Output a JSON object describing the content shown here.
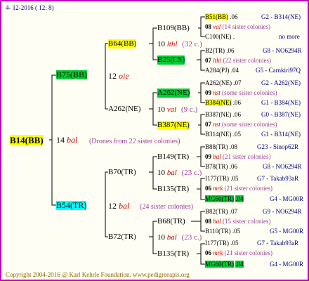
{
  "header": {
    "date": "4- 12-2016 ( 12: 8)"
  },
  "colors": {
    "yellow": "#ffff00",
    "green": "#00cc33",
    "cyan": "#00ffff",
    "text_purple": "#9a3c9a",
    "text_navy": "#000080",
    "text_red": "#d00000",
    "border": "#c000c0"
  },
  "root": {
    "id": "B14(BB)",
    "gen": "14",
    "loc": "bal",
    "note": "(Drones from 22 sister colonies)"
  },
  "sire": {
    "id": "B75(BB)",
    "gen": "12",
    "loc": "oie",
    "b64": {
      "id": "B64(BB)",
      "gen": "10",
      "loc": "lthl",
      "count": "(32 c.)"
    },
    "b109": {
      "id": "B109(BB)"
    },
    "b25": {
      "id": "B25(CS)"
    },
    "a262": {
      "id": "A262(NE)",
      "gen": "10",
      "loc": "val",
      "count": "(9 c.)"
    },
    "a262b": {
      "id": "A262(NE)"
    },
    "b387": {
      "id": "B387(NE)"
    }
  },
  "dam": {
    "id": "B54(TR)",
    "gen": "12",
    "loc": "bal",
    "note": "(24 sister colonies)",
    "b70": {
      "id": "B70(TR)",
      "gen": "10",
      "loc": "bal",
      "count": "(23 c.)"
    },
    "b149": {
      "id": "B149(TR)"
    },
    "b135": {
      "id": "B135(TR)"
    },
    "b72": {
      "id": "B72(TR)",
      "gen": "10",
      "loc": "bal",
      "count": "(23 c.)"
    },
    "b68": {
      "id": "B68(TR)"
    },
    "b135b": {
      "id": "B135(TR)"
    }
  },
  "rows": [
    {
      "a": "B51(BB)",
      "b": ".06",
      "c": "G2 - B314(NE)"
    },
    {
      "a": "08",
      "b": "val",
      "c": "(14 sister colonies)"
    },
    {
      "a": "C100(NE)",
      "b": ".",
      "c": "no more"
    },
    {
      "a": "B2(TR)",
      "b": ".06",
      "c": "G8 - NO6294R"
    },
    {
      "a": "07",
      "b": "lthl",
      "c": "(22 sister colonies)"
    },
    {
      "a": "A284(PJ)",
      "b": ".04",
      "c": "G5 - Carnkiri97Q"
    },
    {
      "a": "A262(NE)",
      "b": ".07",
      "c": "G2 - A262(NE)"
    },
    {
      "a": "09",
      "b": "nst",
      "c": "(some sister colonies)"
    },
    {
      "a": "B384(NE)",
      "b": ".06",
      "c": "G1 - B384(NE)"
    },
    {
      "a": "B387(NE)",
      "b": ".06",
      "c": "G0 - B387(NE)"
    },
    {
      "a": "07",
      "b": "nst",
      "c": "(some sister colonies)"
    },
    {
      "a": "B314(NE)",
      "b": ".05",
      "c": "G1 - B314(NE)"
    },
    {
      "a": "B88(TR)",
      "b": ".08",
      "c": "G23 - Sinop62R"
    },
    {
      "a": "09",
      "b": "bal",
      "c": "(21 sister colonies)"
    },
    {
      "a": "B78(TR)",
      "b": ".06",
      "c": "G8 - NO6294R"
    },
    {
      "a": "I177(TR)",
      "b": ".05",
      "c": "G7 - Takab93aR"
    },
    {
      "a": "06",
      "b": "mrk",
      "c": "(21 sister colonies)"
    },
    {
      "a": "MG60(TR)",
      "b": ".04",
      "c": "G4 - MG00R"
    },
    {
      "a": "B82(TR)",
      "b": ".07",
      "c": "G9 - NO6294R"
    },
    {
      "a": "08",
      "b": "bal",
      "c": "(15 sister colonies)"
    },
    {
      "a": "B110(TR)",
      "b": ".05",
      "c": "G5 - MG00R"
    },
    {
      "a": "I177(TR)",
      "b": ".05",
      "c": "G7 - Takab93aR"
    },
    {
      "a": "06",
      "b": "mrk",
      "c": "(21 sister colonies)"
    },
    {
      "a": "MG60(TR)",
      "b": ".04",
      "c": "G4 - MG00R"
    }
  ],
  "footer": {
    "text": "Copyright 2004-2016 @ Karl Kehrle Foundation.   www.pedigreeapis.org"
  }
}
